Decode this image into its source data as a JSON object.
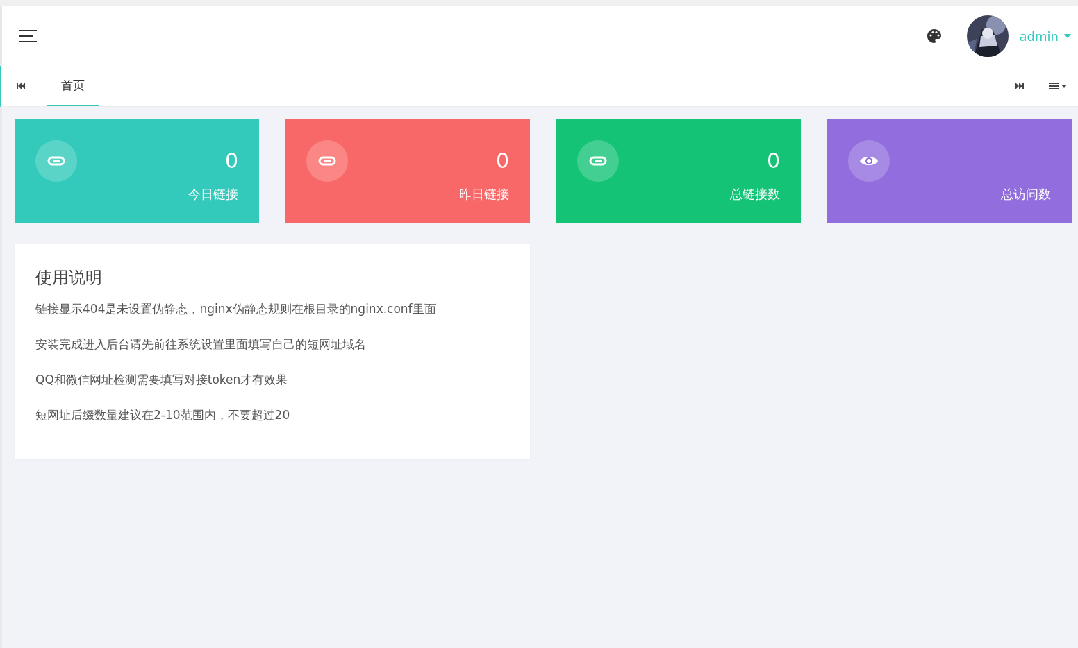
{
  "header": {
    "user": {
      "name": "admin"
    }
  },
  "tabs": [
    {
      "label": "首页",
      "selected": true
    }
  ],
  "stats": [
    {
      "kind": "link",
      "color": "#33cabb",
      "value": "0",
      "label": "今日链接"
    },
    {
      "kind": "link",
      "color": "#f96868",
      "value": "0",
      "label": "昨日链接"
    },
    {
      "kind": "link",
      "color": "#15c377",
      "value": "0",
      "label": "总链接数"
    },
    {
      "kind": "eye",
      "color": "#926dde",
      "label": "总访问数"
    }
  ],
  "instructions": {
    "title": "使用说明",
    "lines": [
      "链接显示404是未设置伪静态，nginx伪静态规则在根目录的nginx.conf里面",
      "安装完成进入后台请先前往系统设置里面填写自己的短网址域名",
      "QQ和微信网址检测需要填写对接token才有效果",
      "短网址后缀数量建议在2-10范围内，不要超过20"
    ]
  }
}
